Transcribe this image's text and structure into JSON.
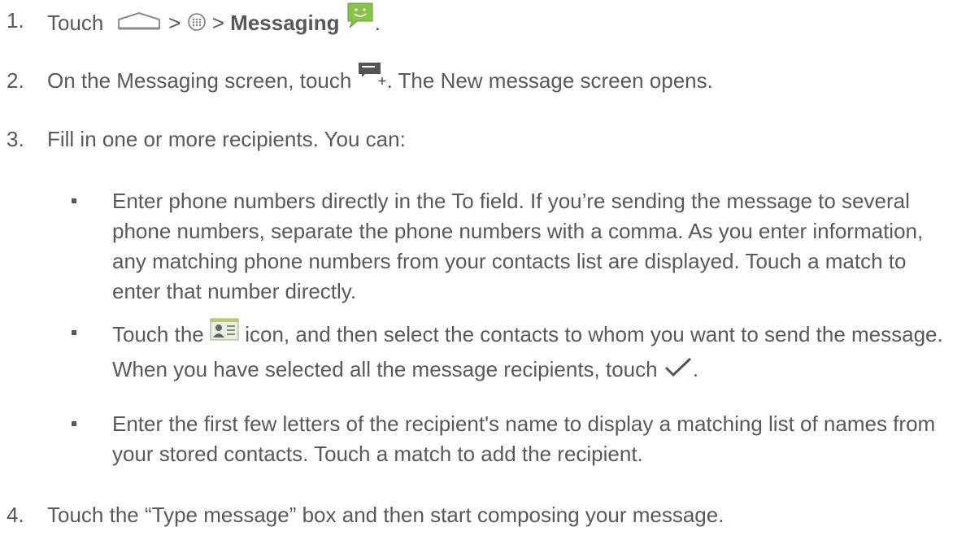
{
  "steps": [
    {
      "num": "1.",
      "t_touch": "Touch",
      "t_sep1": ">",
      "t_sep2": ">",
      "t_app": "Messaging",
      "t_end": "."
    },
    {
      "num": "2.",
      "t_before": "On the Messaging screen, touch",
      "t_after": ". The New message screen opens."
    },
    {
      "num": "3.",
      "text": "Fill in one or more recipients. You can:"
    },
    {
      "num": "4.",
      "text": "Touch the “Type message” box and then start composing your message."
    }
  ],
  "bullets": [
    {
      "text": "Enter phone numbers directly in the To field. If you’re sending the message to several phone numbers, separate the phone numbers with a comma. As you enter information, any matching phone numbers from your contacts list are displayed. Touch a match to enter that number directly."
    },
    {
      "t_before": "Touch the",
      "t_mid": "icon, and then select the contacts to whom you want to send the message. When you have selected all the message recipients, touch",
      "t_end": "."
    },
    {
      "text": "Enter the first few letters of the recipient's name to display a matching list of names from your stored contacts. Touch a match to add the recipient."
    }
  ],
  "icons": {
    "home": "home-icon",
    "apps": "apps-icon",
    "messaging": "messaging-app-icon",
    "compose": "compose-message-icon",
    "contacts": "contacts-picker-icon",
    "checkmark": "checkmark-icon"
  },
  "colors": {
    "text": "#595959",
    "messaging_green": "#8bc34a"
  }
}
